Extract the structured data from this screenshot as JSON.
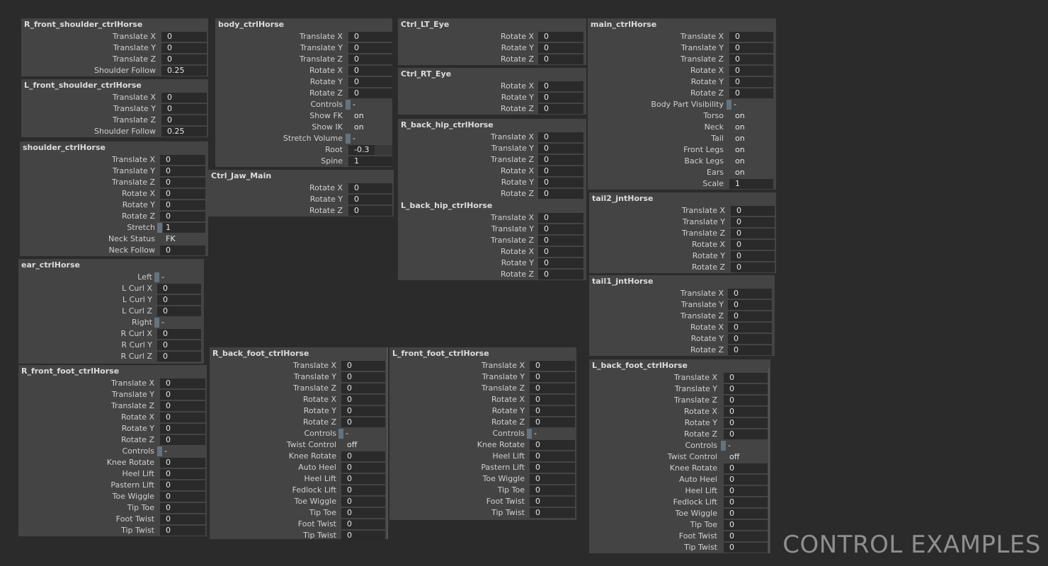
{
  "panels": [
    {
      "id": "R_front_shoulder",
      "title": "R_front_shoulder_ctrlHorse",
      "rows": [
        {
          "label": "Translate X",
          "value": "0"
        },
        {
          "label": "Translate Y",
          "value": "0"
        },
        {
          "label": "Translate Z",
          "value": "0"
        },
        {
          "label": "Shoulder Follow",
          "value": "0.25"
        }
      ]
    },
    {
      "id": "L_front_shoulder",
      "title": "L_front_shoulder_ctrlHorse",
      "rows": [
        {
          "label": "Translate X",
          "value": "0"
        },
        {
          "label": "Translate Y",
          "value": "0"
        },
        {
          "label": "Translate Z",
          "value": "0"
        },
        {
          "label": "Shoulder Follow",
          "value": "0.25"
        }
      ]
    },
    {
      "id": "shoulder",
      "title": "shoulder_ctrlHorse",
      "rows": [
        {
          "label": "Translate X",
          "value": "0"
        },
        {
          "label": "Translate Y",
          "value": "0"
        },
        {
          "label": "Translate Z",
          "value": "0"
        },
        {
          "label": "Rotate X",
          "value": "0"
        },
        {
          "label": "Rotate Y",
          "value": "0"
        },
        {
          "label": "Rotate Z",
          "value": "0"
        },
        {
          "label": "Stretch",
          "value": "1",
          "type": "checkfield"
        },
        {
          "label": "Neck Status",
          "value": "FK",
          "type": "text"
        },
        {
          "label": "Neck Follow",
          "value": "0"
        }
      ]
    },
    {
      "id": "ear",
      "title": "ear_ctrlHorse",
      "rows": [
        {
          "label": "Left",
          "value": "-",
          "type": "check"
        },
        {
          "label": "L Curl X",
          "value": "0"
        },
        {
          "label": "L Curl Y",
          "value": "0"
        },
        {
          "label": "L Curl Z",
          "value": "0"
        },
        {
          "label": "Right",
          "value": "-",
          "type": "check"
        },
        {
          "label": "R Curl X",
          "value": "0"
        },
        {
          "label": "R Curl Y",
          "value": "0"
        },
        {
          "label": "R Curl Z",
          "value": "0"
        }
      ]
    },
    {
      "id": "R_front_foot",
      "title": "R_front_foot_ctrlHorse",
      "rows": [
        {
          "label": "Translate X",
          "value": "0"
        },
        {
          "label": "Translate Y",
          "value": "0"
        },
        {
          "label": "Translate Z",
          "value": "0"
        },
        {
          "label": "Rotate X",
          "value": "0"
        },
        {
          "label": "Rotate Y",
          "value": "0"
        },
        {
          "label": "Rotate Z",
          "value": "0"
        },
        {
          "label": "Controls",
          "value": "-",
          "type": "check"
        },
        {
          "label": "Knee Rotate",
          "value": "0"
        },
        {
          "label": "Heel Lift",
          "value": "0"
        },
        {
          "label": "Pastern Lift",
          "value": "0"
        },
        {
          "label": "Toe Wiggle",
          "value": "0"
        },
        {
          "label": "Tip Toe",
          "value": "0"
        },
        {
          "label": "Foot Twist",
          "value": "0"
        },
        {
          "label": "Tip Twist",
          "value": "0"
        }
      ]
    },
    {
      "id": "body",
      "title": "body_ctrlHorse",
      "rows": [
        {
          "label": "Translate X",
          "value": "0"
        },
        {
          "label": "Translate Y",
          "value": "0"
        },
        {
          "label": "Translate Z",
          "value": "0"
        },
        {
          "label": "Rotate X",
          "value": "0"
        },
        {
          "label": "Rotate Y",
          "value": "0"
        },
        {
          "label": "Rotate Z",
          "value": "0"
        },
        {
          "label": "Controls",
          "value": "-",
          "type": "check"
        },
        {
          "label": "Show FK",
          "value": "on",
          "type": "text"
        },
        {
          "label": "Show IK",
          "value": "on",
          "type": "text"
        },
        {
          "label": "Stretch Volume",
          "value": "-",
          "type": "check"
        },
        {
          "label": "Root",
          "value": "-0.3",
          "type": "slider",
          "fill": 0.6
        },
        {
          "label": "Spine",
          "value": "1",
          "type": "slider",
          "fill": 1.0
        }
      ]
    },
    {
      "id": "jaw",
      "title": "Ctrl_Jaw_Main",
      "rows": [
        {
          "label": "Rotate X",
          "value": "0"
        },
        {
          "label": "Rotate Y",
          "value": "0"
        },
        {
          "label": "Rotate Z",
          "value": "0"
        }
      ]
    },
    {
      "id": "R_back_foot",
      "title": "R_back_foot_ctrlHorse",
      "rows": [
        {
          "label": "Translate X",
          "value": "0"
        },
        {
          "label": "Translate Y",
          "value": "0"
        },
        {
          "label": "Translate Z",
          "value": "0"
        },
        {
          "label": "Rotate X",
          "value": "0"
        },
        {
          "label": "Rotate Y",
          "value": "0"
        },
        {
          "label": "Rotate Z",
          "value": "0"
        },
        {
          "label": "Controls",
          "value": "-",
          "type": "check"
        },
        {
          "label": "Twist Control",
          "value": "off",
          "type": "text"
        },
        {
          "label": "Knee Rotate",
          "value": "0"
        },
        {
          "label": "Auto Heel",
          "value": "0"
        },
        {
          "label": "Heel Lift",
          "value": "0"
        },
        {
          "label": "Fedlock Lift",
          "value": "0"
        },
        {
          "label": "Toe Wiggle",
          "value": "0"
        },
        {
          "label": "Tip Toe",
          "value": "0"
        },
        {
          "label": "Foot Twist",
          "value": "0"
        },
        {
          "label": "Tip Twist",
          "value": "0"
        }
      ]
    },
    {
      "id": "LT_Eye",
      "title": "Ctrl_LT_Eye",
      "rows": [
        {
          "label": "Rotate X",
          "value": "0"
        },
        {
          "label": "Rotate Y",
          "value": "0"
        },
        {
          "label": "Rotate Z",
          "value": "0"
        }
      ]
    },
    {
      "id": "RT_Eye",
      "title": "Ctrl_RT_Eye",
      "rows": [
        {
          "label": "Rotate X",
          "value": "0"
        },
        {
          "label": "Rotate Y",
          "value": "0"
        },
        {
          "label": "Rotate Z",
          "value": "0"
        }
      ]
    },
    {
      "id": "R_back_hip",
      "title": "R_back_hip_ctrlHorse",
      "rows": [
        {
          "label": "Translate X",
          "value": "0"
        },
        {
          "label": "Translate Y",
          "value": "0"
        },
        {
          "label": "Translate Z",
          "value": "0"
        },
        {
          "label": "Rotate X",
          "value": "0"
        },
        {
          "label": "Rotate Y",
          "value": "0"
        },
        {
          "label": "Rotate Z",
          "value": "0"
        }
      ]
    },
    {
      "id": "L_back_hip",
      "title": "L_back_hip_ctrlHorse",
      "rows": [
        {
          "label": "Translate X",
          "value": "0"
        },
        {
          "label": "Translate Y",
          "value": "0"
        },
        {
          "label": "Translate Z",
          "value": "0"
        },
        {
          "label": "Rotate X",
          "value": "0"
        },
        {
          "label": "Rotate Y",
          "value": "0"
        },
        {
          "label": "Rotate Z",
          "value": "0"
        }
      ]
    },
    {
      "id": "L_front_foot",
      "title": "L_front_foot_ctrlHorse",
      "rows": [
        {
          "label": "Translate X",
          "value": "0"
        },
        {
          "label": "Translate Y",
          "value": "0"
        },
        {
          "label": "Translate Z",
          "value": "0"
        },
        {
          "label": "Rotate X",
          "value": "0"
        },
        {
          "label": "Rotate Y",
          "value": "0"
        },
        {
          "label": "Rotate Z",
          "value": "0"
        },
        {
          "label": "Controls",
          "value": "-",
          "type": "check"
        },
        {
          "label": "Knee Rotate",
          "value": "0"
        },
        {
          "label": "Heel Lift",
          "value": "0"
        },
        {
          "label": "Pastern Lift",
          "value": "0"
        },
        {
          "label": "Toe Wiggle",
          "value": "0"
        },
        {
          "label": "Tip Toe",
          "value": "0"
        },
        {
          "label": "Foot Twist",
          "value": "0"
        },
        {
          "label": "Tip Twist",
          "value": "0"
        }
      ]
    },
    {
      "id": "main",
      "title": "main_ctrlHorse",
      "rows": [
        {
          "label": "Translate X",
          "value": "0"
        },
        {
          "label": "Translate Y",
          "value": "0"
        },
        {
          "label": "Translate Z",
          "value": "0"
        },
        {
          "label": "Rotate X",
          "value": "0"
        },
        {
          "label": "Rotate Y",
          "value": "0"
        },
        {
          "label": "Rotate Z",
          "value": "0"
        },
        {
          "label": "Body Part Visibility",
          "value": "-",
          "type": "check"
        },
        {
          "label": "Torso",
          "value": "on",
          "type": "text"
        },
        {
          "label": "Neck",
          "value": "on",
          "type": "text"
        },
        {
          "label": "Tail",
          "value": "on",
          "type": "text"
        },
        {
          "label": "Front Legs",
          "value": "on",
          "type": "text"
        },
        {
          "label": "Back Legs",
          "value": "on",
          "type": "text"
        },
        {
          "label": "Ears",
          "value": "on",
          "type": "text"
        },
        {
          "label": "Scale",
          "value": "1"
        }
      ]
    },
    {
      "id": "tail2",
      "title": "tail2_jntHorse",
      "rows": [
        {
          "label": "Translate X",
          "value": "0"
        },
        {
          "label": "Translate Y",
          "value": "0"
        },
        {
          "label": "Translate Z",
          "value": "0"
        },
        {
          "label": "Rotate X",
          "value": "0"
        },
        {
          "label": "Rotate Y",
          "value": "0"
        },
        {
          "label": "Rotate Z",
          "value": "0"
        }
      ]
    },
    {
      "id": "tail1",
      "title": "tail1_jntHorse",
      "rows": [
        {
          "label": "Translate X",
          "value": "0"
        },
        {
          "label": "Translate Y",
          "value": "0"
        },
        {
          "label": "Translate Z",
          "value": "0"
        },
        {
          "label": "Rotate X",
          "value": "0"
        },
        {
          "label": "Rotate Y",
          "value": "0"
        },
        {
          "label": "Rotate Z",
          "value": "0"
        }
      ]
    },
    {
      "id": "L_back_foot",
      "title": "L_back_foot_ctrlHorse",
      "rows": [
        {
          "label": "Translate X",
          "value": "0"
        },
        {
          "label": "Translate Y",
          "value": "0"
        },
        {
          "label": "Translate Z",
          "value": "0"
        },
        {
          "label": "Rotate X",
          "value": "0"
        },
        {
          "label": "Rotate Y",
          "value": "0"
        },
        {
          "label": "Rotate Z",
          "value": "0"
        },
        {
          "label": "Controls",
          "value": "-",
          "type": "check"
        },
        {
          "label": "Twist Control",
          "value": "off",
          "type": "text"
        },
        {
          "label": "Knee Rotate",
          "value": "0"
        },
        {
          "label": "Auto Heel",
          "value": "0"
        },
        {
          "label": "Heel Lift",
          "value": "0"
        },
        {
          "label": "Fedlock Lift",
          "value": "0"
        },
        {
          "label": "Toe Wiggle",
          "value": "0"
        },
        {
          "label": "Tip Toe",
          "value": "0"
        },
        {
          "label": "Foot Twist",
          "value": "0"
        },
        {
          "label": "Tip Twist",
          "value": "0"
        }
      ]
    }
  ],
  "footer": {
    "caption": "CONTROL EXAMPLES"
  },
  "colors": {
    "background": "#2b2b2b",
    "panel": "#444444",
    "field": "#2a2a2a",
    "checkbox": "#66737d",
    "caption": "#8f8f8f"
  }
}
